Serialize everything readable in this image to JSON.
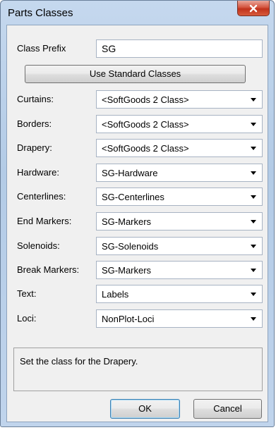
{
  "window": {
    "title": "Parts Classes",
    "close_label": "X"
  },
  "class_prefix": {
    "label": "Class Prefix",
    "value": "SG"
  },
  "standard_button": "Use Standard Classes",
  "fields": [
    {
      "label": "Curtains:",
      "value": "<SoftGoods 2 Class>"
    },
    {
      "label": "Borders:",
      "value": "<SoftGoods 2 Class>"
    },
    {
      "label": "Drapery:",
      "value": "<SoftGoods 2 Class>"
    },
    {
      "label": "Hardware:",
      "value": "SG-Hardware"
    },
    {
      "label": "Centerlines:",
      "value": "SG-Centerlines"
    },
    {
      "label": "End Markers:",
      "value": "SG-Markers"
    },
    {
      "label": "Solenoids:",
      "value": "SG-Solenoids"
    },
    {
      "label": "Break Markers:",
      "value": "SG-Markers"
    },
    {
      "label": "Text:",
      "value": "Labels"
    },
    {
      "label": "Loci:",
      "value": "NonPlot-Loci"
    }
  ],
  "help_text": "Set the class for the Drapery.",
  "buttons": {
    "ok": "OK",
    "cancel": "Cancel"
  }
}
